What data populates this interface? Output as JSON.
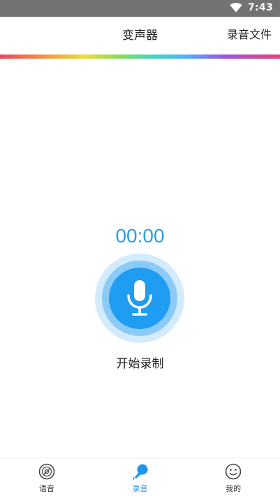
{
  "status_bar": {
    "time": "7:43",
    "wifi_icon": "wifi-icon"
  },
  "app_bar": {
    "title": "变声器",
    "files_label": "录音文件"
  },
  "recorder": {
    "timer": "00:00",
    "record_label": "开始录制",
    "mic_icon": "microphone-icon"
  },
  "colors": {
    "accent": "#1e9df2",
    "ring_mid": "#8ccbf8",
    "ring_outer": "#d3ebfc",
    "timer": "#2c9ee7",
    "tab_active": "#2196e8"
  },
  "tabs": [
    {
      "label": "语音",
      "icon": "vinyl-disc-icon",
      "active": false
    },
    {
      "label": "录音",
      "icon": "microphone-tab-icon",
      "active": true
    },
    {
      "label": "我的",
      "icon": "smiley-face-icon",
      "active": false
    }
  ]
}
